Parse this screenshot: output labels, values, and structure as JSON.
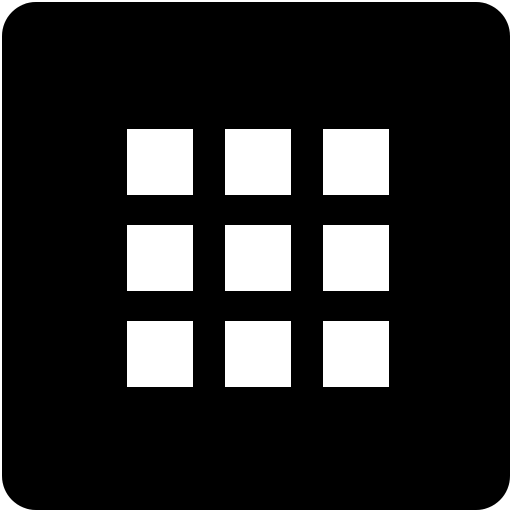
{
  "icon": {
    "name": "apps-grid-icon",
    "background_color": "#000000",
    "cell_color": "#ffffff",
    "rows": 3,
    "columns": 3
  }
}
